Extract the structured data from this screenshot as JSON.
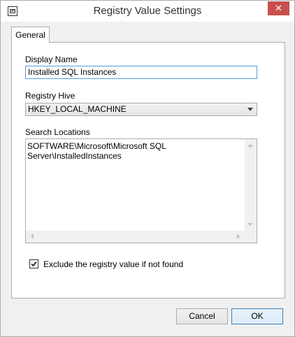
{
  "window": {
    "title": "Registry Value Settings",
    "close_glyph": "✕",
    "icon": "ab-textbox-icon",
    "icon_text": "ab"
  },
  "tabs": [
    {
      "label": "General",
      "selected": true
    }
  ],
  "fields": {
    "display_name_label": "Display Name",
    "display_name_value": "Installed SQL Instances",
    "registry_hive_label": "Registry Hive",
    "registry_hive_value": "HKEY_LOCAL_MACHINE",
    "search_locations_label": "Search Locations",
    "search_locations": [
      "SOFTWARE\\Microsoft\\Microsoft SQL Server\\InstalledInstances"
    ]
  },
  "options": {
    "exclude_if_not_found_label": "Exclude the registry value if not found",
    "exclude_if_not_found_checked": true
  },
  "buttons": {
    "cancel_label": "Cancel",
    "ok_label": "OK"
  },
  "colors": {
    "close_button": "#c7504d",
    "focus_border": "#569de5",
    "default_button_border": "#3c7fb1"
  }
}
